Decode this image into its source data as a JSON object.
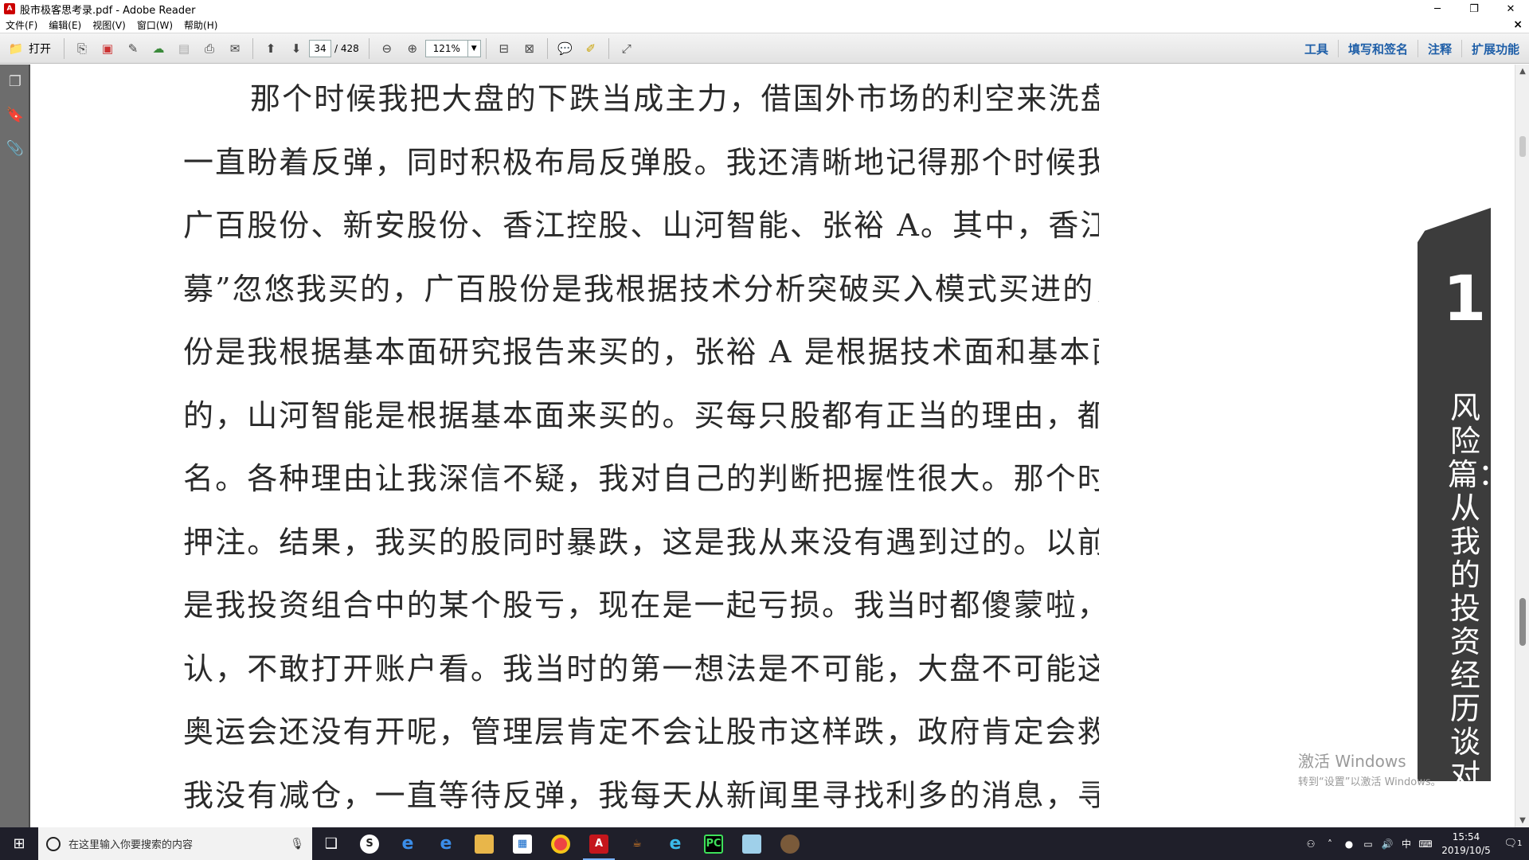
{
  "window": {
    "title": "股市极客思考录.pdf - Adobe Reader",
    "app_icon_letter": "A",
    "minimize": "─",
    "restore": "❐",
    "close": "✕"
  },
  "menu": {
    "items": [
      "文件(F)",
      "编辑(E)",
      "视图(V)",
      "窗口(W)",
      "帮助(H)"
    ],
    "close": "×"
  },
  "toolbar": {
    "open_label": "打开",
    "page_current": "34",
    "page_total": "/ 428",
    "zoom": "121%",
    "right_links": [
      "工具",
      "填写和签名",
      "注释",
      "扩展功能"
    ]
  },
  "document": {
    "lines": [
      "那个时候我把大盘的下跌当成主力，借国外市场的利空来洗盘。我内心",
      "一直盼着反弹，同时积极布局反弹股。我还清晰地记得那个时候我买的股票：",
      "广百股份、新安股份、香江控股、山河智能、张裕 A。其中，香江控股是“私",
      "募”忽悠我买的，广百股份是我根据技术分析突破买入模式买进的，新安股",
      "份是我根据基本面研究报告来买的，张裕 A 是根据技术面和基本面结合来买",
      "的，山河智能是根据基本面来买的。买每只股都有正当的理由，都是师出有",
      "名。各种理由让我深信不疑，我对自己的判断把握性很大。那个时候我是全仓",
      "押注。结果，我买的股同时暴跌，这是我从来没有遇到过的。以前亏损，顶多",
      "是我投资组合中的某个股亏，现在是一起亏损。我当时都傻蒙啦，不愿意承",
      "认，不敢打开账户看。我当时的第一想法是不可能，大盘不可能这样跌下去，",
      "奥运会还没有开呢，管理层肯定不会让股市这样跌，政府肯定会救市。所以，",
      "我没有减仓，一直等待反弹，我每天从新闻里寻找利多的消息，寻找股市反弹"
    ],
    "chapter_number": "1",
    "chapter_title": "风险篇：从我的投资经历谈对"
  },
  "watermark": {
    "line1": "激活 Windows",
    "line2": "转到“设置”以激活 Windows。"
  },
  "taskbar": {
    "search_placeholder": "在这里输入你要搜索的内容",
    "time": "15:54",
    "date": "2019/10/5",
    "ime": "中",
    "notifications": "1"
  }
}
